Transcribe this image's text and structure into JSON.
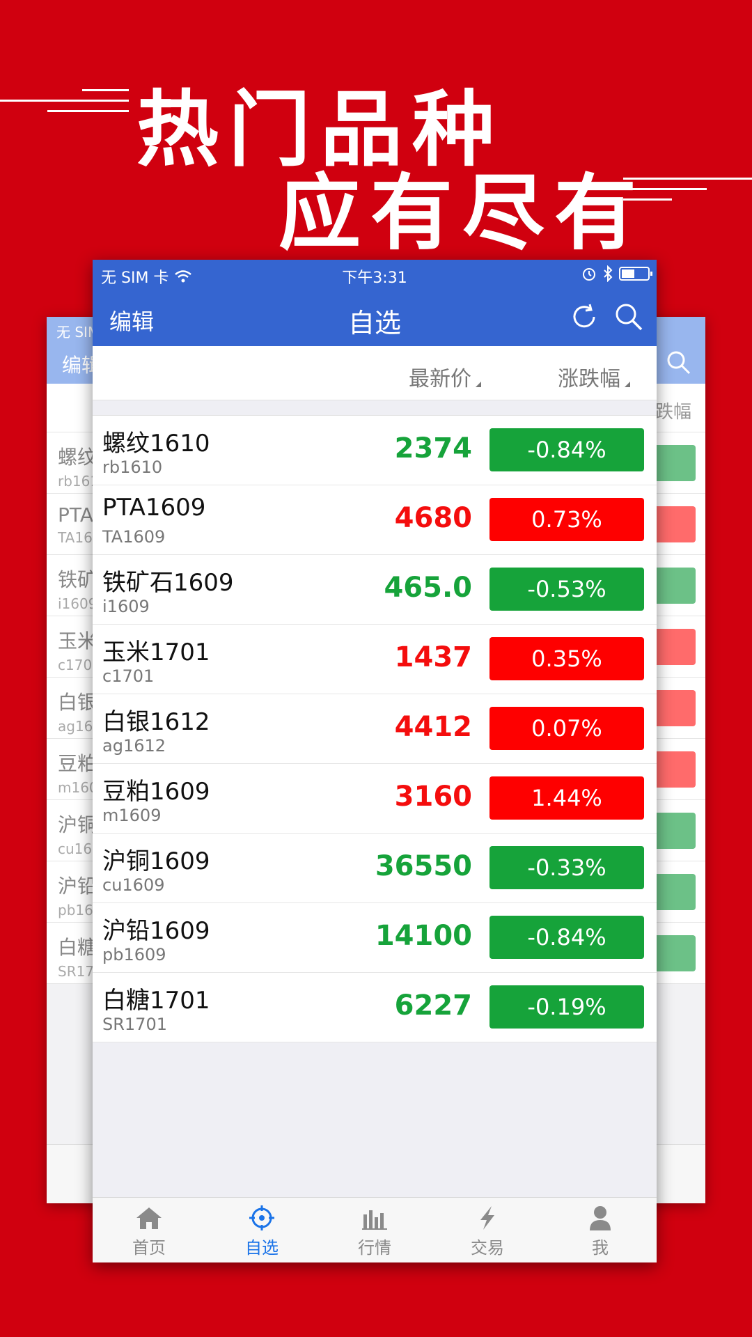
{
  "banner": {
    "line1": "热门品种",
    "line2": "应有尽有"
  },
  "status_bar": {
    "carrier": "无 SIM 卡",
    "time": "下午3:31"
  },
  "nav": {
    "edit": "编辑",
    "title": "自选"
  },
  "columns": {
    "price": "最新价",
    "change": "涨跌幅"
  },
  "rows": [
    {
      "name": "螺纹1610",
      "code": "rb1610",
      "price": "2374",
      "change": "-0.84%",
      "dir": "down"
    },
    {
      "name": "PTA1609",
      "code": "TA1609",
      "price": "4680",
      "change": "0.73%",
      "dir": "up"
    },
    {
      "name": "铁矿石1609",
      "code": "i1609",
      "price": "465.0",
      "change": "-0.53%",
      "dir": "down"
    },
    {
      "name": "玉米1701",
      "code": "c1701",
      "price": "1437",
      "change": "0.35%",
      "dir": "up"
    },
    {
      "name": "白银1612",
      "code": "ag1612",
      "price": "4412",
      "change": "0.07%",
      "dir": "up"
    },
    {
      "name": "豆粕1609",
      "code": "m1609",
      "price": "3160",
      "change": "1.44%",
      "dir": "up"
    },
    {
      "name": "沪铜1609",
      "code": "cu1609",
      "price": "36550",
      "change": "-0.33%",
      "dir": "down"
    },
    {
      "name": "沪铅1609",
      "code": "pb1609",
      "price": "14100",
      "change": "-0.84%",
      "dir": "down"
    },
    {
      "name": "白糖1701",
      "code": "SR1701",
      "price": "6227",
      "change": "-0.19%",
      "dir": "down"
    }
  ],
  "tabs": [
    {
      "label": "首页",
      "icon": "home-icon"
    },
    {
      "label": "自选",
      "icon": "crosshair-icon"
    },
    {
      "label": "行情",
      "icon": "bar-chart-icon"
    },
    {
      "label": "交易",
      "icon": "lightning-icon"
    },
    {
      "label": "我",
      "icon": "user-icon"
    }
  ],
  "back_card": {
    "carrier": "无 SIM",
    "edit": "编辑",
    "change_header": "涨跌幅",
    "rows": [
      {
        "name": "螺纹",
        "code": "rb161"
      },
      {
        "name": "PTA",
        "code": "TA16"
      },
      {
        "name": "铁矿",
        "code": "i1609"
      },
      {
        "name": "玉米",
        "code": "c170"
      },
      {
        "name": "白银",
        "code": "ag16"
      },
      {
        "name": "豆粕",
        "code": "m160"
      },
      {
        "name": "沪铜",
        "code": "cu16"
      },
      {
        "name": "沪铅",
        "code": "pb16"
      },
      {
        "name": "白糖",
        "code": "SR17"
      }
    ]
  },
  "colors": {
    "background": "#d0000f",
    "nav": "#3565d0",
    "up": "#fe0000",
    "down": "#16a33a",
    "tab_active": "#1a73e8"
  }
}
